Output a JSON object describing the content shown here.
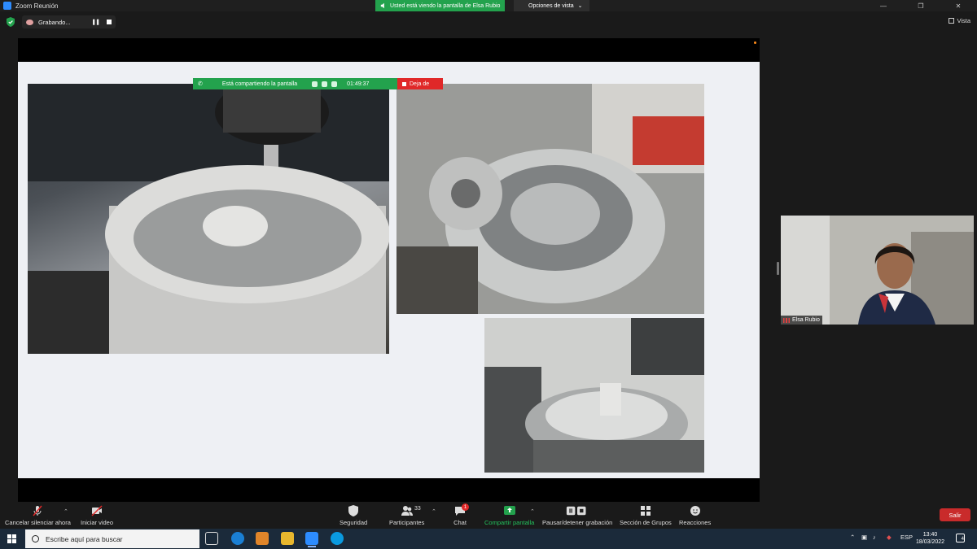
{
  "window": {
    "title": "Zoom Reunión",
    "share_banner": "Usted está viendo la pantalla de Elsa Rubio",
    "view_options": "Opciones de vista"
  },
  "meeting_top": {
    "recording_label": "Grabando...",
    "vista_label": "Vista"
  },
  "share_bar": {
    "label": "Está compartiendo la pantalla",
    "timer": "01:49:37",
    "stop_label": "Deja de"
  },
  "participant": {
    "name": "Elsa Rubio"
  },
  "toolbar": {
    "mute_label": "Cancelar silenciar ahora",
    "video_label": "Iniciar video",
    "security_label": "Seguridad",
    "participants_label": "Participantes",
    "participants_count": "33",
    "chat_label": "Chat",
    "chat_badge": "1",
    "share_label": "Compartir pantalla",
    "record_label": "Pausar/detener grabación",
    "breakout_label": "Sección de Grupos",
    "reactions_label": "Reacciones",
    "leave_label": "Salir",
    "colors": {
      "share_green": "#23a24d",
      "leave_red": "#c92b2b"
    }
  },
  "taskbar": {
    "search_placeholder": "Escribe aquí para buscar",
    "language": "ESP",
    "time": "13:40",
    "date": "18/03/2022",
    "notifications": "4"
  }
}
